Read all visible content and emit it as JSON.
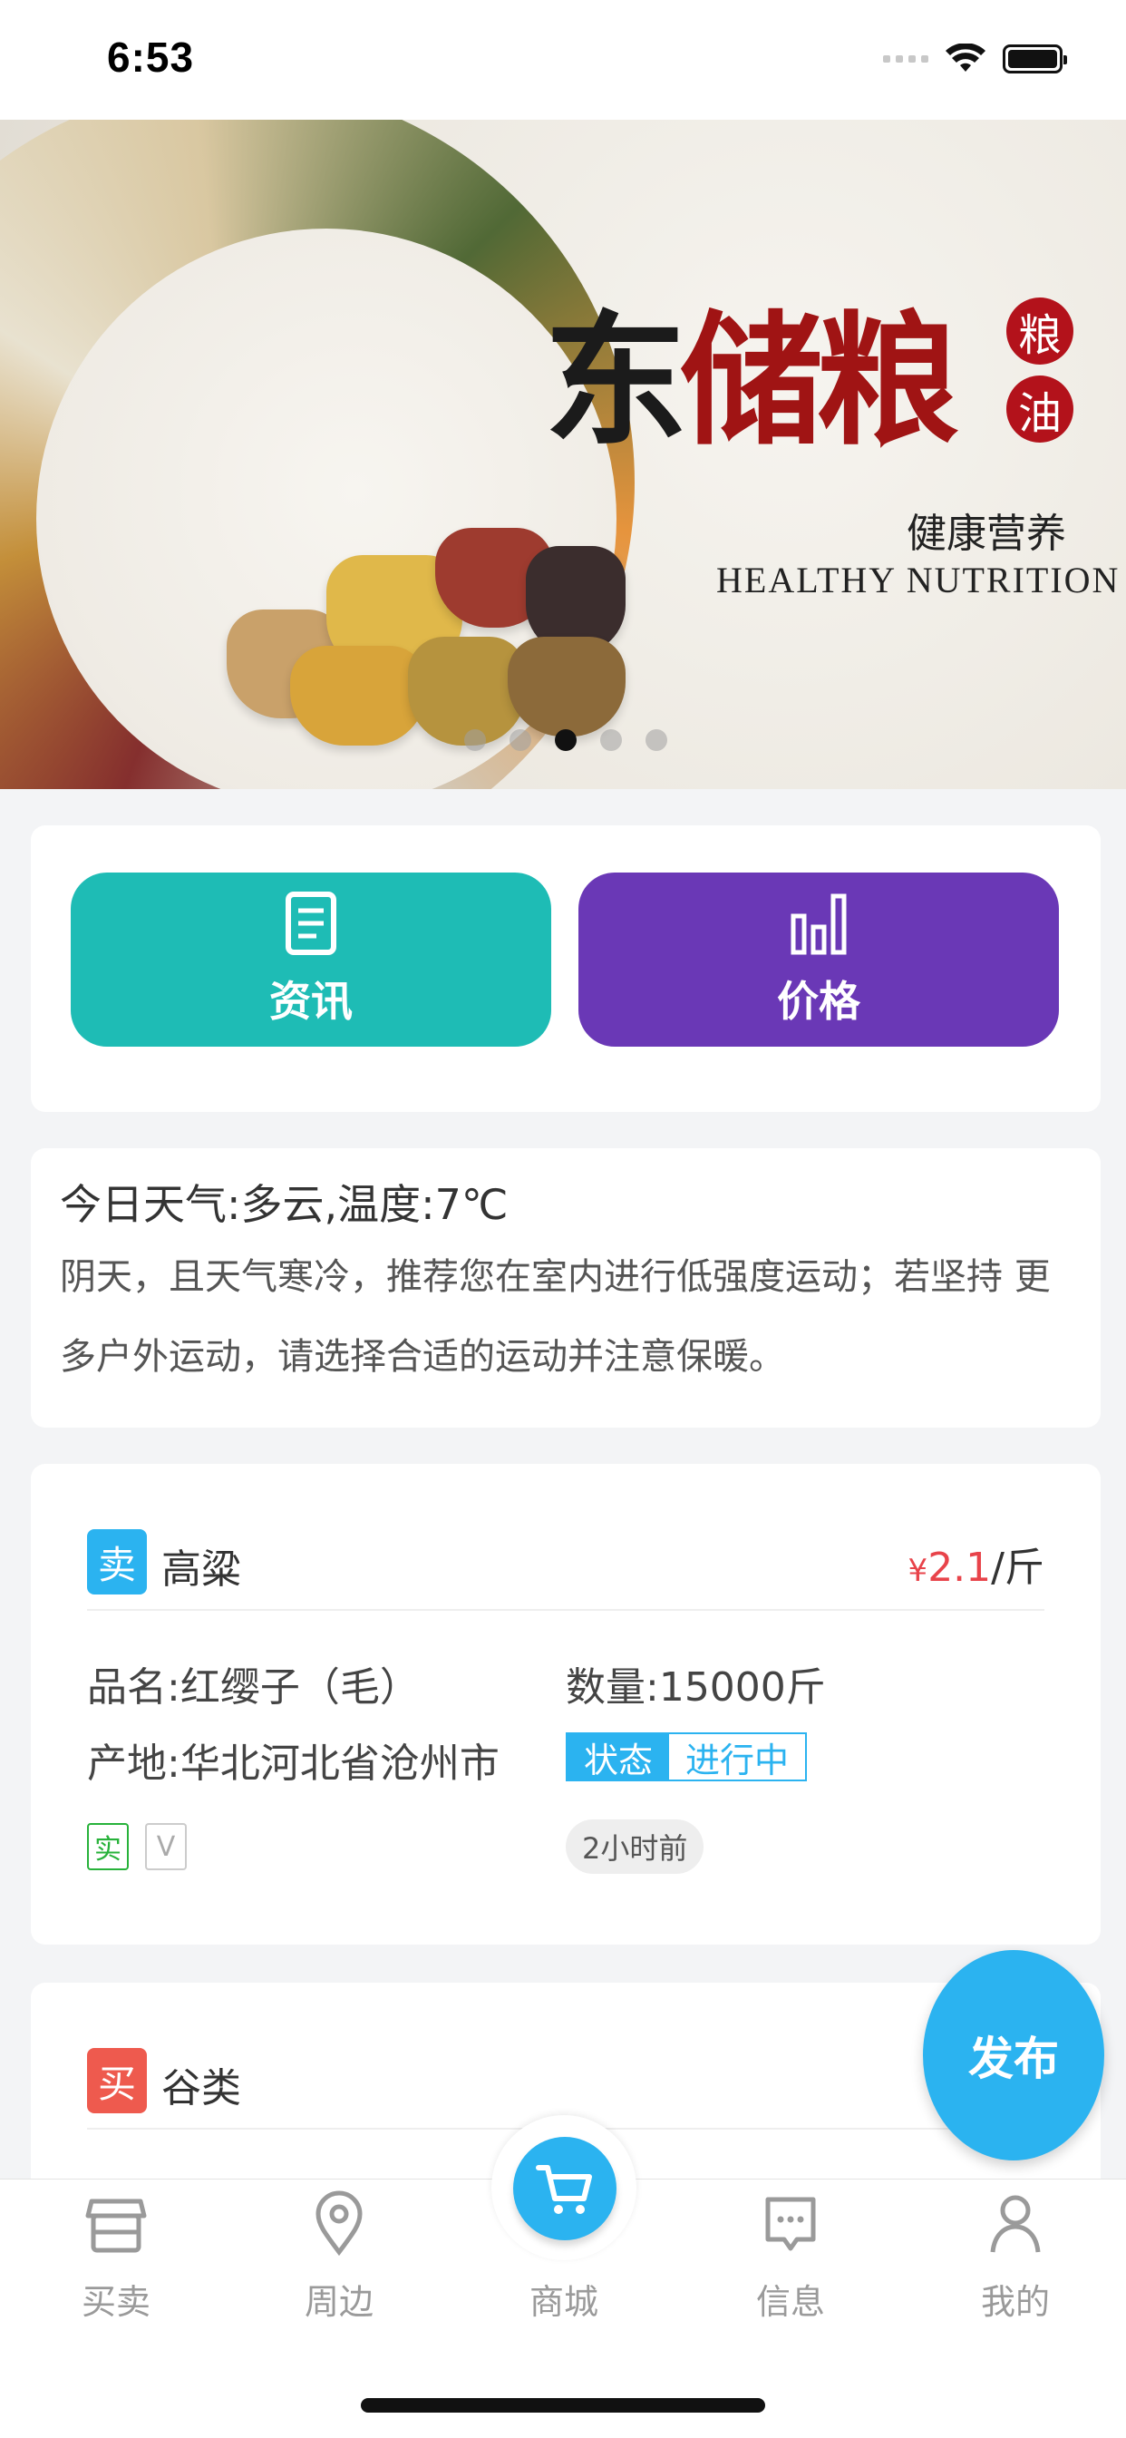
{
  "status_bar": {
    "time": "6:53"
  },
  "banner": {
    "title_black": "东",
    "title_red": "储",
    "title_black_2": "粮",
    "seal_1": "粮",
    "seal_2": "油",
    "subtitle_cn": "健康营养",
    "subtitle_en": "HEALTHY NUTRITION",
    "carousel_total": 5,
    "carousel_active_index": 3
  },
  "quick_actions": {
    "news_label": "资讯",
    "price_label": "价格",
    "news_color": "#1ebcb5",
    "price_color": "#6a38b6"
  },
  "weather": {
    "title": "今日天气:多云,温度:7℃",
    "description": "阴天，且天气寒冷，推荐您在室内进行低强度运动；若坚持 更多户外运动，请选择合适的运动并注意保暖。"
  },
  "listings": [
    {
      "type": "卖",
      "product": "高粱",
      "currency": "¥",
      "price": "2.1",
      "unit": "/斤",
      "name": "品名:红缨子（毛）",
      "quantity": "数量:15000斤",
      "origin": "产地:华北河北省沧州市",
      "status_key": "状态",
      "status_value": "进行中",
      "badge_real": "实",
      "badge_v": "V",
      "time": "2小时前"
    },
    {
      "type": "买",
      "product": "谷类"
    }
  ],
  "fab": {
    "label": "发布"
  },
  "tabbar": {
    "items": [
      {
        "label": "买卖",
        "icon": "store-icon"
      },
      {
        "label": "周边",
        "icon": "location-pin-icon"
      },
      {
        "label": "商城",
        "icon": "cart-icon"
      },
      {
        "label": "信息",
        "icon": "message-icon"
      },
      {
        "label": "我的",
        "icon": "user-icon"
      }
    ]
  },
  "colors": {
    "accent": "#2bb3f0",
    "price_red": "#e8434a",
    "sell_badge": "#2bb3f0",
    "buy_badge": "#ee5a4e"
  }
}
